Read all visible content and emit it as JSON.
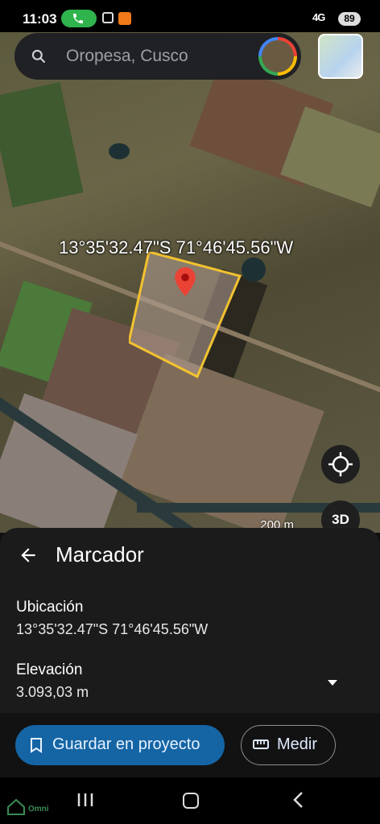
{
  "status_bar": {
    "time": "11:03",
    "signal": "4G",
    "battery": "89"
  },
  "map": {
    "search_text": "Oropesa, Cusco",
    "coordinates_label": "13°35'32.47\"S 71°46'45.56\"W",
    "scale_label": "200 m",
    "button_3d": "3D"
  },
  "sheet": {
    "title": "Marcador",
    "location_label": "Ubicación",
    "location_value": "13°35'32.47\"S 71°46'45.56\"W",
    "elevation_label": "Elevación",
    "elevation_value": "3.093,03 m"
  },
  "actions": {
    "save_label": "Guardar en proyecto",
    "measure_label": "Medir"
  },
  "watermark": {
    "text": "Omni"
  },
  "colors": {
    "save_button": "#1565a5",
    "parcel_outline": "#f2c230",
    "pin": "#ea4335",
    "call_pill": "#2fb34d"
  }
}
